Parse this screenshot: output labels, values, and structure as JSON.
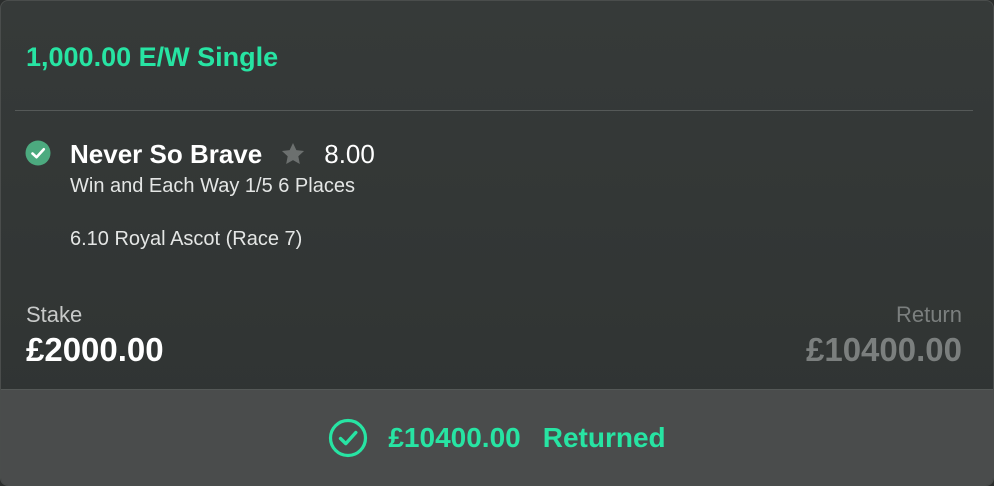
{
  "bet": {
    "title": "1,000.00 E/W Single"
  },
  "selection": {
    "status_icon": "check-circle-icon",
    "name": "Never So Brave",
    "favourite_icon": "star-icon",
    "odds": "8.00",
    "market": "Win and Each Way 1/5 6 Places",
    "event": "6.10 Royal Ascot (Race 7)"
  },
  "summary": {
    "stake_label": "Stake",
    "stake_value": "£2000.00",
    "return_label": "Return",
    "return_value": "£10400.00"
  },
  "result": {
    "icon": "check-circle-outline-icon",
    "amount": "£10400.00",
    "status": "Returned"
  },
  "colors": {
    "accent": "#27e4a3",
    "card_background": "#363a39",
    "footer_background": "#4a4c4c",
    "muted_text": "#7b7f7e",
    "success_icon": "#4caa7f"
  }
}
